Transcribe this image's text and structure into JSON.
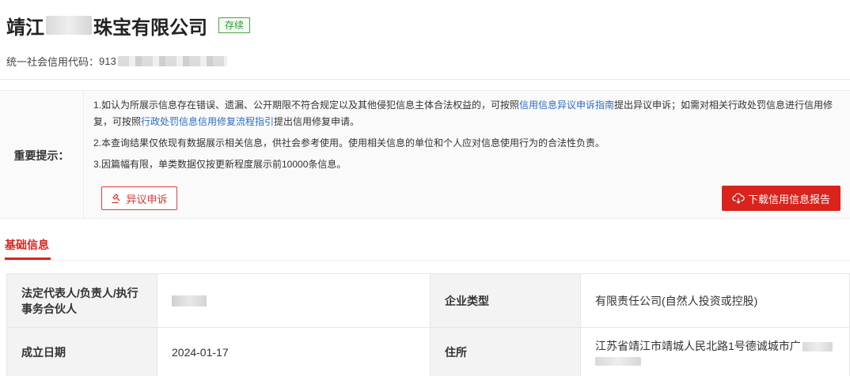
{
  "header": {
    "company_name_prefix": "靖江",
    "company_name_suffix": "珠宝有限公司",
    "status_badge": "存续",
    "credit_code_label": "统一社会信用代码：",
    "credit_code_visible": "913"
  },
  "notice": {
    "label": "重要提示：",
    "item1_part1": "1.如认为所展示信息存在错误、遗漏、公开期限不符合规定以及其他侵犯信息主体合法权益的，可按照",
    "item1_link1": "信用信息异议申诉指南",
    "item1_part2": "提出异议申诉；如需对相关行政处罚信息进行信用修复，可按照",
    "item1_link2": "行政处罚信息信用修复流程指引",
    "item1_part3": "提出信用修复申请。",
    "item2": "2.本查询结果仅依现有数据展示相关信息，供社会参考使用。使用相关信息的单位和个人应对信息使用行为的合法性负责。",
    "item3": "3.因篇幅有限，单类数据仅按更新程度展示前10000条信息。",
    "appeal_button": "异议申诉",
    "download_button": "下载信用信息报告"
  },
  "tabs": {
    "basic_info": "基础信息"
  },
  "table": {
    "legal_rep_label": "法定代表人/负责人/执行事务合伙人",
    "enterprise_type_label": "企业类型",
    "enterprise_type_value": "有限责任公司(自然人投资或控股)",
    "established_label": "成立日期",
    "established_value": "2024-01-17",
    "address_label": "住所",
    "address_value": "江苏省靖江市靖城人民北路1号德诚城市广"
  },
  "colors": {
    "accent": "#d9231c",
    "status_green": "#2e9a34",
    "link": "#2d6cc5"
  }
}
